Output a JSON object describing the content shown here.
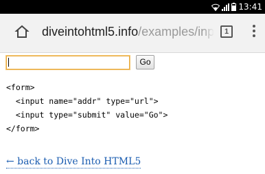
{
  "status_bar": {
    "time": "13:41",
    "icons": [
      "wifi-icon",
      "signal-icon",
      "battery-icon"
    ]
  },
  "browser": {
    "url_host": "diveintohtml5.info",
    "url_path": "/examples/input-",
    "tab_count": "1",
    "icons": [
      "home-icon",
      "menu-icon"
    ]
  },
  "form": {
    "input_value": "",
    "submit_label": "Go"
  },
  "code": {
    "lines": [
      "<form>",
      "  <input name=\"addr\" type=\"url\">",
      "  <input type=\"submit\" value=\"Go\">",
      "</form>"
    ]
  },
  "back_link": {
    "text": "← back to Dive Into HTML5"
  },
  "colors": {
    "input_focus_border": "#e8a83a",
    "link": "#1a5cb0",
    "status_bar_bg": "#000000",
    "toolbar_bg": "#f2f2f2"
  }
}
